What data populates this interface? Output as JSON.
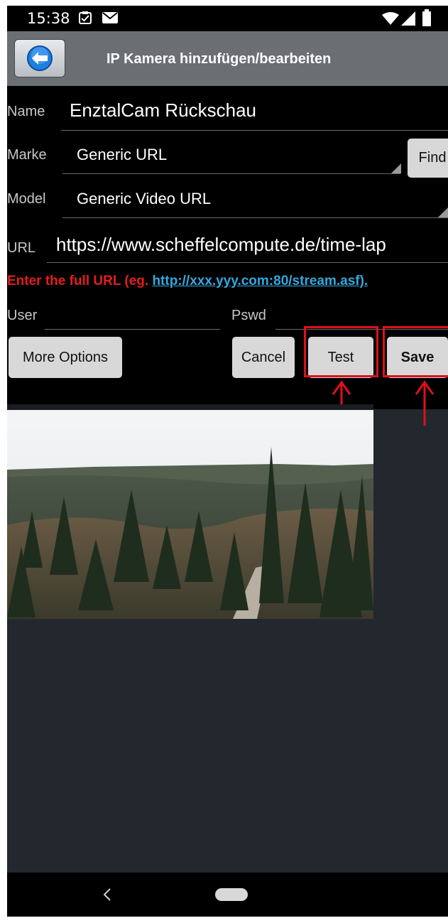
{
  "status_bar": {
    "time": "15:38"
  },
  "header": {
    "title": "IP Kamera hinzufügen/bearbeiten"
  },
  "form": {
    "name_label": "Name",
    "name_value": "EnztalCam Rückschau",
    "marke_label": "Marke",
    "marke_value": "Generic URL",
    "find_label": "Find",
    "model_label": "Model",
    "model_value": "Generic Video URL",
    "url_label": "URL",
    "url_value": "https://www.scheffelcompute.de/time-lap",
    "hint_text": "Enter the full URL (eg. ",
    "hint_link": "http://xxx.yyy.com:80/stream.asf).",
    "user_label": "User",
    "user_value": "",
    "pswd_label": "Pswd",
    "pswd_value": ""
  },
  "buttons": {
    "more_options": "More Options",
    "cancel": "Cancel",
    "test": "Test",
    "save": "Save"
  },
  "colors": {
    "highlight": "#e0101a",
    "accent_link": "#34a8e0",
    "hint_red": "#e61c1c"
  }
}
